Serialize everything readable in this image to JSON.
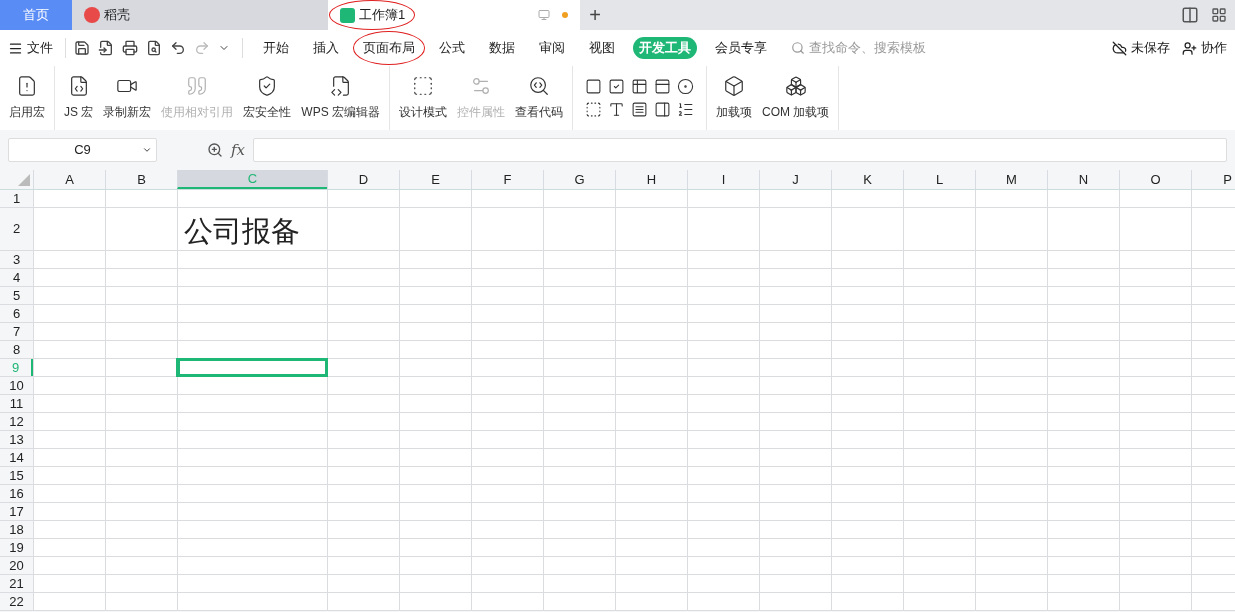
{
  "tabs": [
    {
      "label": "首页",
      "kind": "home",
      "selected": false,
      "circled": false
    },
    {
      "label": "稻壳",
      "kind": "docer",
      "selected": false,
      "circled": false
    },
    {
      "label": "工作簿1",
      "kind": "sheet",
      "selected": true,
      "circled": true,
      "unsaved_dot": true
    }
  ],
  "tab_new": "+",
  "menu": {
    "file": "文件",
    "tabs": [
      {
        "label": "开始",
        "selected": false,
        "circled": false
      },
      {
        "label": "插入",
        "selected": false,
        "circled": false
      },
      {
        "label": "页面布局",
        "selected": false,
        "circled": true
      },
      {
        "label": "公式",
        "selected": false,
        "circled": false
      },
      {
        "label": "数据",
        "selected": false,
        "circled": false
      },
      {
        "label": "审阅",
        "selected": false,
        "circled": false
      },
      {
        "label": "视图",
        "selected": false,
        "circled": false
      },
      {
        "label": "开发工具",
        "selected": true,
        "circled": false
      },
      {
        "label": "会员专享",
        "selected": false,
        "circled": false
      }
    ],
    "search": {
      "placeholder": "查找命令、搜索模板"
    },
    "unsaved": "未保存",
    "collab": "协作"
  },
  "ribbon": [
    [
      {
        "label": "启用宏",
        "disabled": false
      }
    ],
    [
      {
        "label": "JS 宏",
        "disabled": false
      },
      {
        "label": "录制新宏",
        "disabled": false
      },
      {
        "label": "使用相对引用",
        "disabled": true
      },
      {
        "label": "宏安全性",
        "disabled": false
      },
      {
        "label": "WPS 宏编辑器",
        "disabled": false
      }
    ],
    [
      {
        "label": "设计模式",
        "disabled": false
      },
      {
        "label": "控件属性",
        "disabled": true
      },
      {
        "label": "查看代码",
        "disabled": false
      }
    ],
    [
      {
        "label": "加载项",
        "disabled": false
      },
      {
        "label": "COM 加载项",
        "disabled": false
      }
    ]
  ],
  "name_box": "C9",
  "function_label": "fx",
  "sheet": {
    "columns": [
      {
        "label": "A",
        "selected": false
      },
      {
        "label": "B",
        "selected": false
      },
      {
        "label": "C",
        "selected": true
      },
      {
        "label": "D",
        "selected": false
      },
      {
        "label": "E",
        "selected": false
      },
      {
        "label": "F",
        "selected": false
      },
      {
        "label": "G",
        "selected": false
      },
      {
        "label": "H",
        "selected": false
      },
      {
        "label": "I",
        "selected": false
      },
      {
        "label": "J",
        "selected": false
      },
      {
        "label": "K",
        "selected": false
      },
      {
        "label": "L",
        "selected": false
      },
      {
        "label": "M",
        "selected": false
      },
      {
        "label": "N",
        "selected": false
      },
      {
        "label": "O",
        "selected": false
      },
      {
        "label": "P",
        "selected": false
      }
    ],
    "rows": [
      {
        "label": "1"
      },
      {
        "label": "2",
        "cells": {
          "C": "公司报备"
        }
      },
      {
        "label": "3"
      },
      {
        "label": "4"
      },
      {
        "label": "5"
      },
      {
        "label": "6"
      },
      {
        "label": "7"
      },
      {
        "label": "8"
      },
      {
        "label": "9",
        "selected": true
      },
      {
        "label": "10"
      },
      {
        "label": "11"
      },
      {
        "label": "12"
      },
      {
        "label": "13"
      },
      {
        "label": "14"
      },
      {
        "label": "15"
      },
      {
        "label": "16"
      },
      {
        "label": "17"
      },
      {
        "label": "18"
      },
      {
        "label": "19"
      },
      {
        "label": "20"
      },
      {
        "label": "21"
      },
      {
        "label": "22"
      }
    ]
  }
}
